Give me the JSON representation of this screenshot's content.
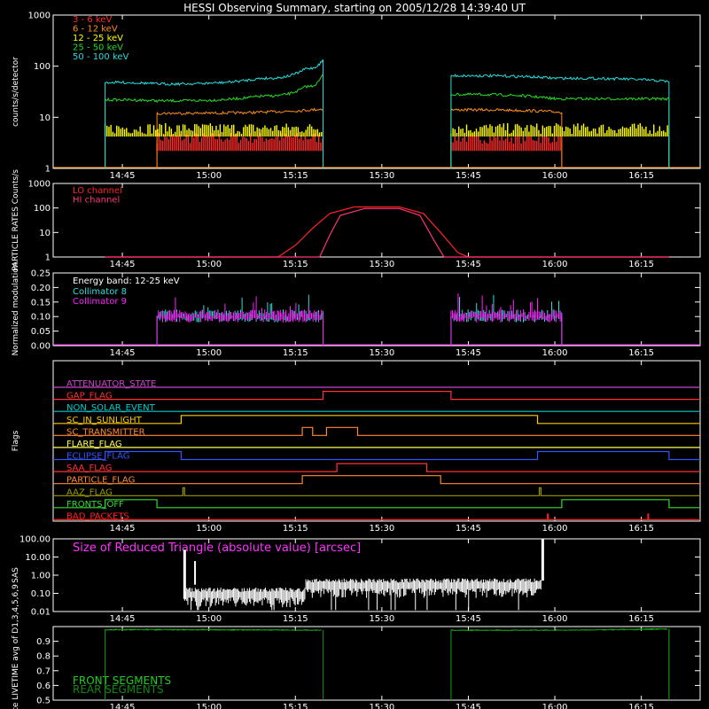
{
  "title": "HESSI Observing Summary, starting on 2005/12/28 14:39:40 UT",
  "colors": {
    "background": "#000000",
    "axes": "#ffffff",
    "e3_6": "#ff2a2a",
    "e6_12": "#ff8c1a",
    "e12_25": "#ffff00",
    "e25_50": "#22dd22",
    "e50_100": "#22dddd",
    "lo": "#ff2222",
    "hi": "#ff3377",
    "energy_band": "#ffffff",
    "coll8": "#33dddd",
    "coll9": "#ff22ff",
    "sas": "#ffffff",
    "sas_title": "#ff33ff",
    "front": "#22cc22",
    "rear": "#118811"
  },
  "time_axis": {
    "ticks": [
      "14:45",
      "15:00",
      "15:15",
      "15:30",
      "15:45",
      "16:00",
      "16:15"
    ]
  },
  "chart_data": [
    {
      "id": "counts",
      "type": "line",
      "ylabel": "counts/s/detector",
      "yscale": "log",
      "ylim": [
        1,
        1000
      ],
      "yticks": [
        "1",
        "10",
        "100",
        "1000"
      ],
      "legend_position": "top-left",
      "series": [
        {
          "name": "3 - 6 keV",
          "color_key": "e3_6",
          "segments": [
            [
              [
                14.85,
                3.6
              ],
              [
                15.33,
                3.6
              ]
            ],
            [
              [
                15.7,
                3.6
              ],
              [
                16.02,
                3.6
              ]
            ]
          ]
        },
        {
          "name": "6 - 12 keV",
          "color_key": "e6_12",
          "segments": [
            [
              [
                14.85,
                12.0
              ],
              [
                15.33,
                14.5
              ]
            ],
            [
              [
                15.7,
                14.0
              ],
              [
                16.02,
                12.5
              ]
            ]
          ]
        },
        {
          "name": "12 - 25 keV",
          "color_key": "e12_25",
          "segments": [
            [
              [
                14.7,
                5.5
              ],
              [
                14.85,
                5.5
              ],
              [
                15.33,
                5.0
              ]
            ],
            [
              [
                15.7,
                5.5
              ],
              [
                16.02,
                5.5
              ],
              [
                16.03,
                7.5
              ],
              [
                16.33,
                6.0
              ]
            ]
          ]
        },
        {
          "name": "25 - 50 keV",
          "color_key": "e25_50",
          "segments": [
            [
              [
                14.7,
                22
              ],
              [
                14.85,
                21
              ],
              [
                15.15,
                26
              ],
              [
                15.28,
                40
              ],
              [
                15.33,
                70
              ]
            ],
            [
              [
                15.7,
                28
              ],
              [
                16.0,
                23
              ],
              [
                16.33,
                23
              ]
            ]
          ]
        },
        {
          "name": "50 - 100 keV",
          "color_key": "e50_100",
          "segments": [
            [
              [
                14.7,
                48
              ],
              [
                14.85,
                45
              ],
              [
                15.15,
                58
              ],
              [
                15.28,
                90
              ],
              [
                15.33,
                135
              ]
            ],
            [
              [
                15.7,
                65
              ],
              [
                16.0,
                58
              ],
              [
                16.33,
                50
              ]
            ]
          ]
        }
      ]
    },
    {
      "id": "particle",
      "type": "line",
      "ylabel": "PARTICLE RATES Counts/s",
      "yscale": "log",
      "ylim": [
        1,
        1000
      ],
      "yticks": [
        "1",
        "10",
        "100",
        "1000"
      ],
      "legend_position": "top-left",
      "series": [
        {
          "name": "LO channel",
          "color_key": "lo",
          "points": [
            [
              14.7,
              1
            ],
            [
              15.2,
              1
            ],
            [
              15.25,
              3
            ],
            [
              15.3,
              15
            ],
            [
              15.35,
              60
            ],
            [
              15.42,
              110
            ],
            [
              15.55,
              110
            ],
            [
              15.62,
              60
            ],
            [
              15.67,
              10
            ],
            [
              15.72,
              1.5
            ],
            [
              15.75,
              1
            ],
            [
              16.33,
              1
            ]
          ]
        },
        {
          "name": "HI channel",
          "color_key": "hi",
          "points": [
            [
              14.7,
              1
            ],
            [
              15.32,
              1
            ],
            [
              15.35,
              8
            ],
            [
              15.38,
              50
            ],
            [
              15.45,
              95
            ],
            [
              15.55,
              95
            ],
            [
              15.61,
              50
            ],
            [
              15.65,
              5
            ],
            [
              15.68,
              1
            ],
            [
              16.33,
              1
            ]
          ]
        }
      ]
    },
    {
      "id": "modulation",
      "type": "line",
      "ylabel": "Normalized modulation",
      "ylim": [
        0,
        0.25
      ],
      "yticks": [
        "0.00",
        "0.05",
        "0.10",
        "0.15",
        "0.20",
        "0.25"
      ],
      "legend_position": "top-left",
      "energy_band": "Energy band: 12-25 keV",
      "series": [
        {
          "name": "Collimator 8",
          "color_key": "coll8",
          "segments": [
            [
              14.85,
              15.33
            ],
            [
              15.7,
              16.02
            ]
          ],
          "level": 0.1
        },
        {
          "name": "Collimator 9",
          "color_key": "coll9",
          "segments": [
            [
              14.85,
              15.33
            ],
            [
              15.7,
              16.02
            ]
          ],
          "level": 0.1
        }
      ]
    },
    {
      "id": "flags",
      "type": "line",
      "ylabel": "Flags",
      "series": [
        {
          "name": "ATTENUATOR_STATE",
          "color": "#cc44cc",
          "high": []
        },
        {
          "name": "GAP_FLAG",
          "color": "#ff3333",
          "high": [
            [
              15.33,
              15.7
            ]
          ]
        },
        {
          "name": "NON_SOLAR_EVENT",
          "color": "#00cccc",
          "high": []
        },
        {
          "name": "SC_IN_SUNLIGHT",
          "color": "#ffcc00",
          "high": [
            [
              14.92,
              15.95
            ]
          ]
        },
        {
          "name": "SC_TRANSMITTER",
          "color": "#ff8833",
          "high": [
            [
              15.27,
              15.3
            ],
            [
              15.34,
              15.43
            ]
          ]
        },
        {
          "name": "FLARE_FLAG",
          "color": "#ffff55",
          "high": []
        },
        {
          "name": "ECLIPSE_FLAG",
          "color": "#3355ff",
          "high": [
            [
              14.7,
              14.92
            ],
            [
              15.95,
              16.33
            ]
          ]
        },
        {
          "name": "SAA_FLAG",
          "color": "#ff3333",
          "high": [
            [
              15.37,
              15.63
            ]
          ]
        },
        {
          "name": "PARTICLE_FLAG",
          "color": "#ff8833",
          "high": [
            [
              15.27,
              15.67
            ]
          ]
        },
        {
          "name": "AAZ_FLAG",
          "color": "#999900",
          "high": [
            [
              14.925,
              14.93
            ],
            [
              15.955,
              15.96
            ]
          ]
        },
        {
          "name": "FRONTS_OFF",
          "color": "#33dd33",
          "high": [
            [
              14.7,
              14.85
            ],
            [
              16.02,
              16.33
            ]
          ]
        },
        {
          "name": "BAD_PACKETS",
          "color": "#ff2222",
          "high": []
        }
      ]
    },
    {
      "id": "sas",
      "type": "line",
      "ylabel": "SAS",
      "yscale": "log",
      "ylim": [
        0.01,
        100
      ],
      "yticks": [
        "0.01",
        "0.10",
        "1.00",
        "10.00",
        "100.00"
      ],
      "label": "Size of Reduced Triangle (absolute value) [arcsec]"
    },
    {
      "id": "livetime",
      "type": "line",
      "ylabel": "Mon. Rate LIVETIME avg of D1,3,4,5,6,9",
      "ylim": [
        0.5,
        1.0
      ],
      "yticks": [
        "0.5",
        "0.6",
        "0.7",
        "0.8",
        "0.9"
      ],
      "legend_position": "bottom-left",
      "series": [
        {
          "name": "FRONT SEGMENTS",
          "color_key": "front",
          "segments": [
            [
              [
                14.7,
                0.98
              ],
              [
                15.33,
                0.975
              ]
            ],
            [
              [
                15.7,
                0.975
              ],
              [
                16.33,
                0.985
              ]
            ]
          ]
        },
        {
          "name": "REAR SEGMENTS",
          "color_key": "rear",
          "segments": [
            [
              [
                14.7,
                0.978
              ],
              [
                15.33,
                0.974
              ]
            ],
            [
              [
                15.7,
                0.974
              ],
              [
                16.33,
                0.983
              ]
            ]
          ]
        }
      ]
    }
  ]
}
